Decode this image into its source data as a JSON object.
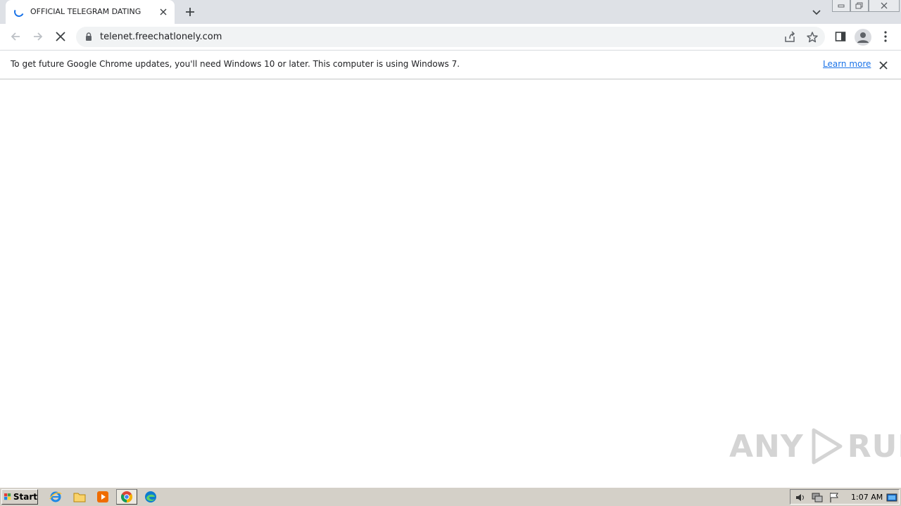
{
  "browser": {
    "tab": {
      "title": "OFFICIAL TELEGRAM DATING"
    },
    "address_bar": {
      "url": "telenet.freechatlonely.com"
    }
  },
  "infobar": {
    "message": "To get future Google Chrome updates, you'll need Windows 10 or later. This computer is using Windows 7.",
    "link_label": "Learn more"
  },
  "watermark": {
    "left": "ANY",
    "right": "RUN"
  },
  "taskbar": {
    "start_label": "Start",
    "clock": "1:07 AM"
  },
  "colors": {
    "tabstrip": "#dee1e6",
    "accent": "#1a73e8",
    "taskbar": "#d4d0c8"
  }
}
